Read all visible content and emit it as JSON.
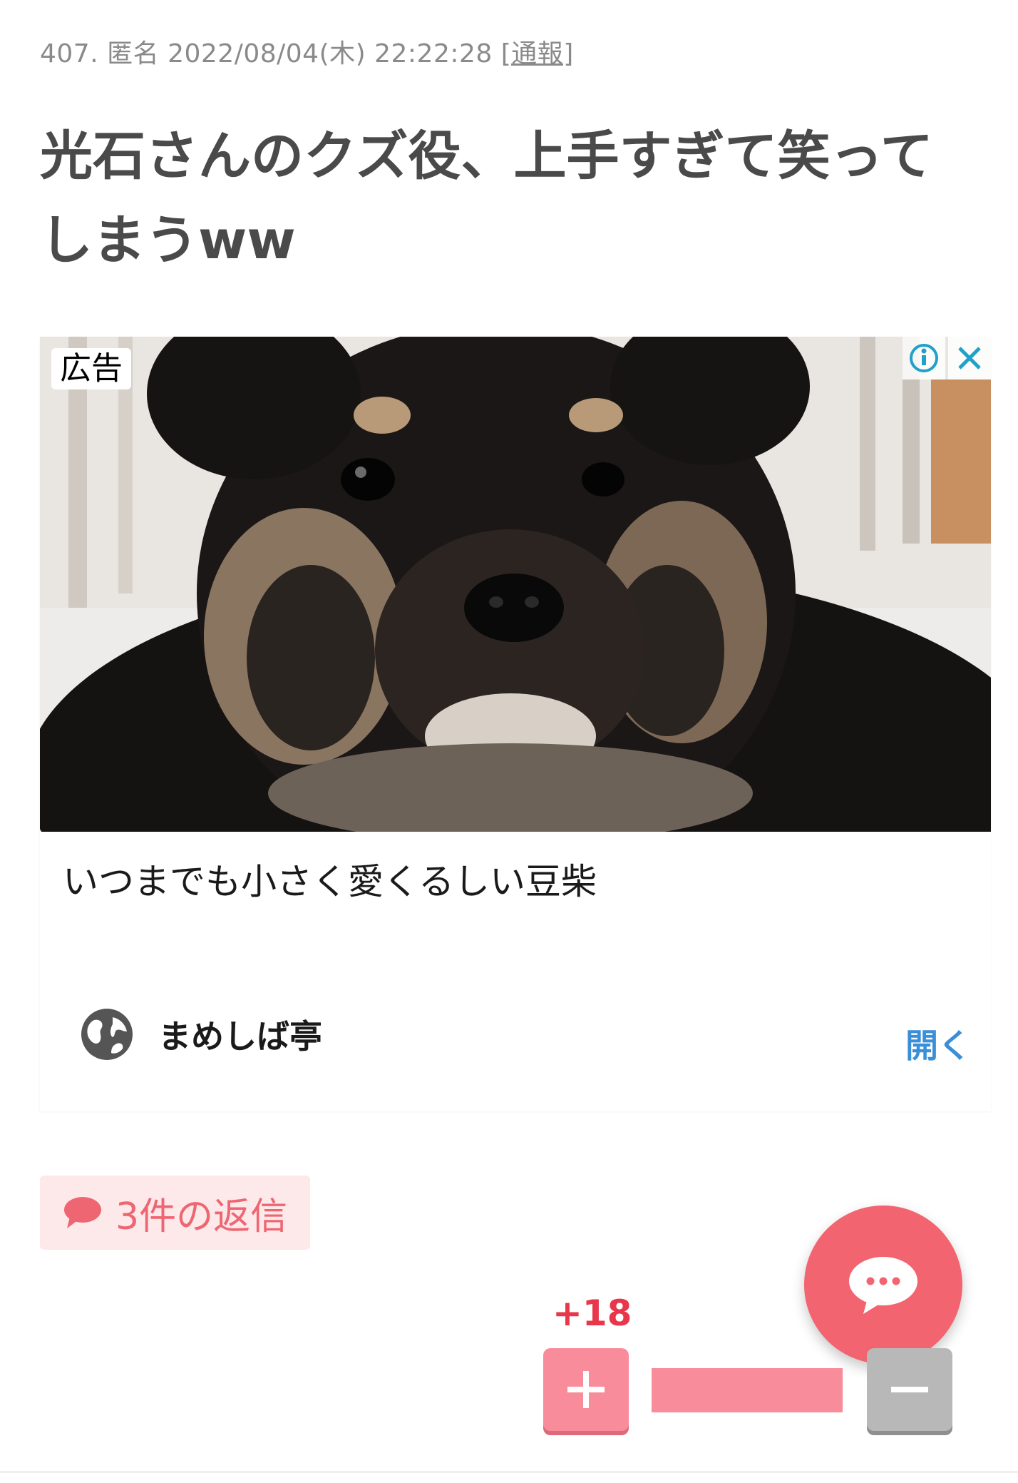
{
  "comment": {
    "number": "407.",
    "author": "匿名",
    "datetime": "2022/08/04(木) 22:22:28",
    "report_label": "[通報]",
    "title": "光石さんのクズ役、上手すぎて笑ってしまうww"
  },
  "ad": {
    "badge": "広告",
    "info_icon": "info-icon",
    "close_icon": "close-icon",
    "image_subject": "shiba-puppy-photo",
    "caption": "いつまでも小さく愛くるしい豆柴",
    "source_icon": "globe-icon",
    "source_name": "まめしば亭",
    "open_label": "開く"
  },
  "replies": {
    "icon": "speech-bubble-icon",
    "label": "3件の返信"
  },
  "fab": {
    "icon": "chat-bubble-icon"
  },
  "vote": {
    "score": "+18",
    "plus_icon": "plus-icon",
    "minus_icon": "minus-icon",
    "positive_ratio": 1.0
  },
  "colors": {
    "accent": "#f2646f",
    "reply_bg": "#fde8ea",
    "reply_text": "#ee6671",
    "score": "#e8374a",
    "link": "#3a8fd8",
    "vote_plus": "#f98c9a",
    "vote_minus": "#b8b8b8"
  }
}
